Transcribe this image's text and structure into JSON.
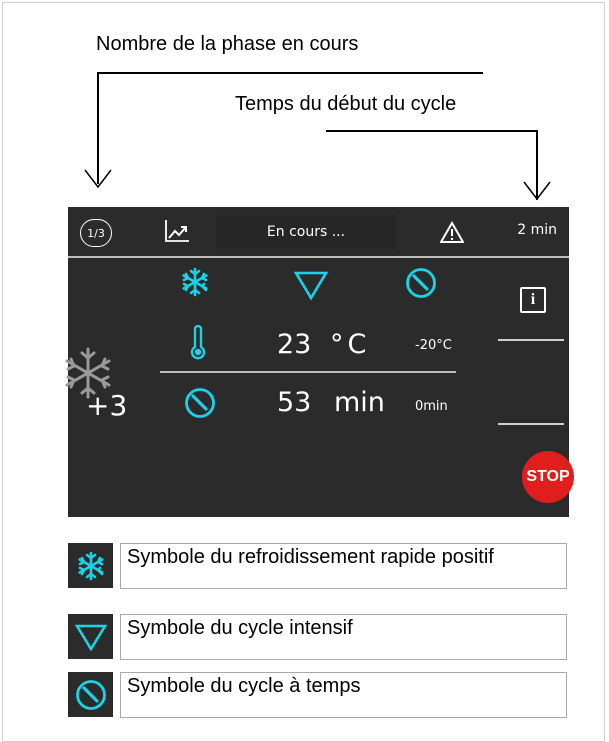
{
  "callouts": {
    "phase_label": "Nombre de la phase en cours",
    "time_label": "Temps du début du cycle"
  },
  "screen": {
    "phase_badge": "1/3",
    "status": "En cours ...",
    "elapsed": "2 min",
    "temperature": {
      "value": "23",
      "unit": "°C",
      "target": "-20°C"
    },
    "duration": {
      "value": "53",
      "unit": "min",
      "target": "0min"
    },
    "room_temp": "+3",
    "info_label": "i",
    "stop_label": "STOP"
  },
  "legend": [
    {
      "icon": "snowflake-icon",
      "text": "Symbole du refroidissement rapide positif"
    },
    {
      "icon": "triangle-down-icon",
      "text": "Symbole du cycle intensif"
    },
    {
      "icon": "clock-icon",
      "text": "Symbole du cycle à temps"
    }
  ],
  "colors": {
    "accent": "#19d3e6",
    "screen_bg": "#2b2b2b",
    "stop": "#e01e1e"
  }
}
